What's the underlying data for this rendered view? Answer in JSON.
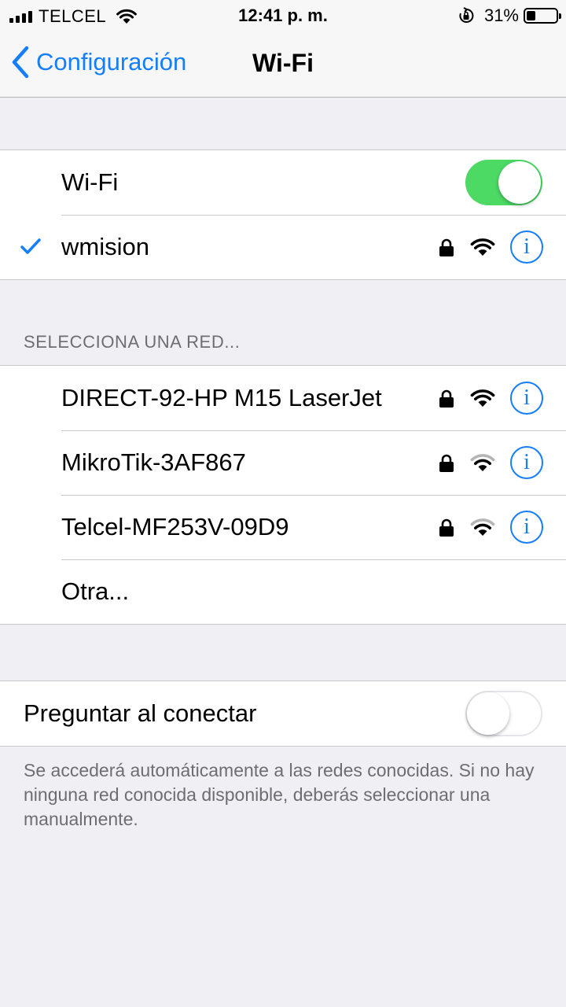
{
  "status_bar": {
    "carrier": "TELCEL",
    "time": "12:41 p. m.",
    "battery_percent": "31%",
    "battery_level": 0.31
  },
  "nav": {
    "back_label": "Configuración",
    "title": "Wi-Fi"
  },
  "wifi": {
    "label": "Wi-Fi",
    "enabled": true,
    "connected_network": "wmision"
  },
  "networks_header": "SELECCIONA UNA RED...",
  "networks": [
    {
      "name": "DIRECT-92-HP M15 LaserJet",
      "secured": true,
      "signal": 3
    },
    {
      "name": "MikroTik-3AF867",
      "secured": true,
      "signal": 2
    },
    {
      "name": "Telcel-MF253V-09D9",
      "secured": true,
      "signal": 2
    }
  ],
  "other_label": "Otra...",
  "ask_to_join": {
    "label": "Preguntar al conectar",
    "enabled": false,
    "note": "Se accederá automáticamente a las redes conocidas. Si no hay ninguna red conocida disponible, deberás seleccionar una manualmente."
  },
  "colors": {
    "accent": "#157efb",
    "toggle_on": "#4cd964",
    "background": "#efeff4"
  },
  "icons": [
    "signal-bars-icon",
    "wifi-icon",
    "rotation-lock-icon",
    "battery-icon",
    "chevron-left-icon",
    "checkmark-icon",
    "lock-icon",
    "info-icon"
  ]
}
